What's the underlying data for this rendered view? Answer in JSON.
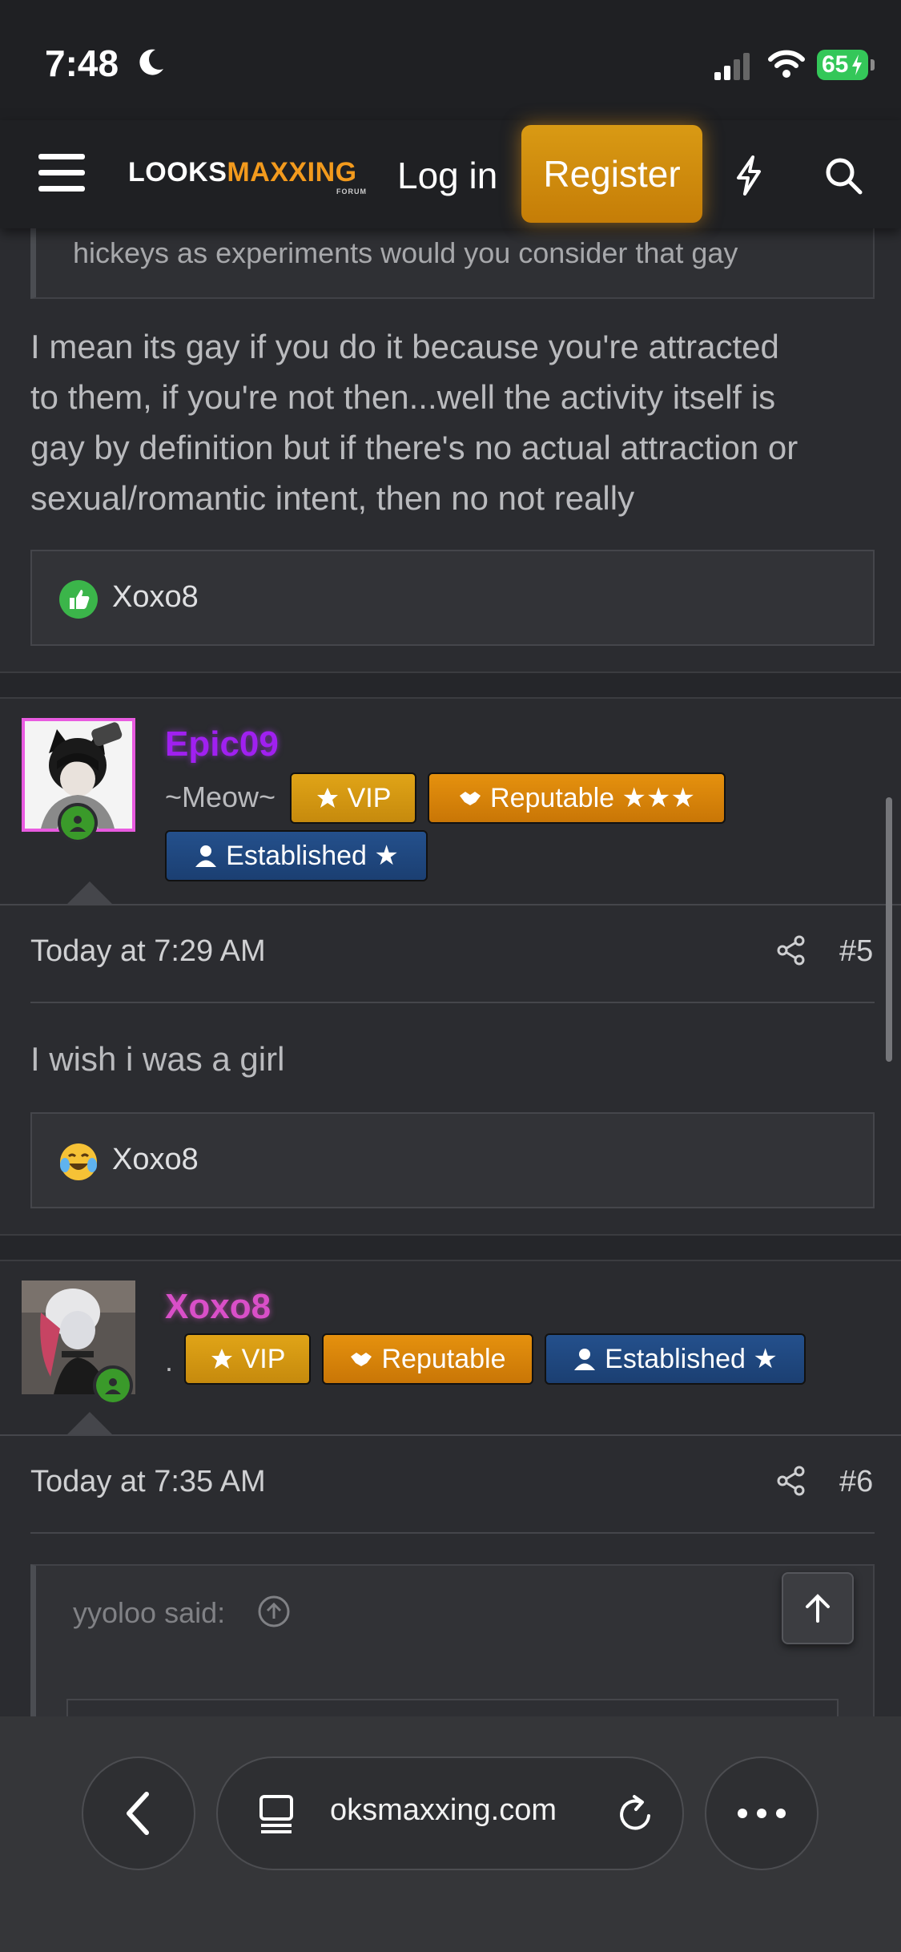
{
  "status_bar": {
    "time": "7:48",
    "battery": "65"
  },
  "nav": {
    "logo_part1": "LOOKS",
    "logo_part2": "MAXXING",
    "logo_sub": "FORUM",
    "login": "Log in",
    "register": "Register"
  },
  "post4": {
    "quote_text": "hickeys as experiments would you consider that gay",
    "body_lines": [
      "I mean its gay if you do it because you're attracted",
      "to them, if you're not then...well the activity itself is",
      "gay by definition but if there's no actual attraction or",
      "sexual/romantic intent, then no not really"
    ],
    "reaction_user": "Xoxo8"
  },
  "post5": {
    "username": "Epic09",
    "user_title": "~Meow~",
    "badges": [
      "VIP",
      "Reputable ★★★",
      "Established ★"
    ],
    "date": "Today at 7:29 AM",
    "post_number": "#5",
    "body": "I wish i was a girl",
    "reaction_user": "Xoxo8"
  },
  "post6": {
    "username": "Xoxo8",
    "user_title": ".",
    "badges": [
      "VIP",
      "Reputable",
      "Established ★"
    ],
    "date": "Today at 7:35 AM",
    "post_number": "#6",
    "quote_author": "yyoloo said:"
  },
  "browser": {
    "url": "oksmaxxing.com"
  },
  "colors": {
    "accent": "#f29a1d",
    "vip": "#d89a12",
    "reputable": "#d9830a",
    "established": "#21497f",
    "epic09_name": "#a020f0",
    "xoxo8_name": "#d94fc8",
    "online": "#3a9a2a"
  }
}
